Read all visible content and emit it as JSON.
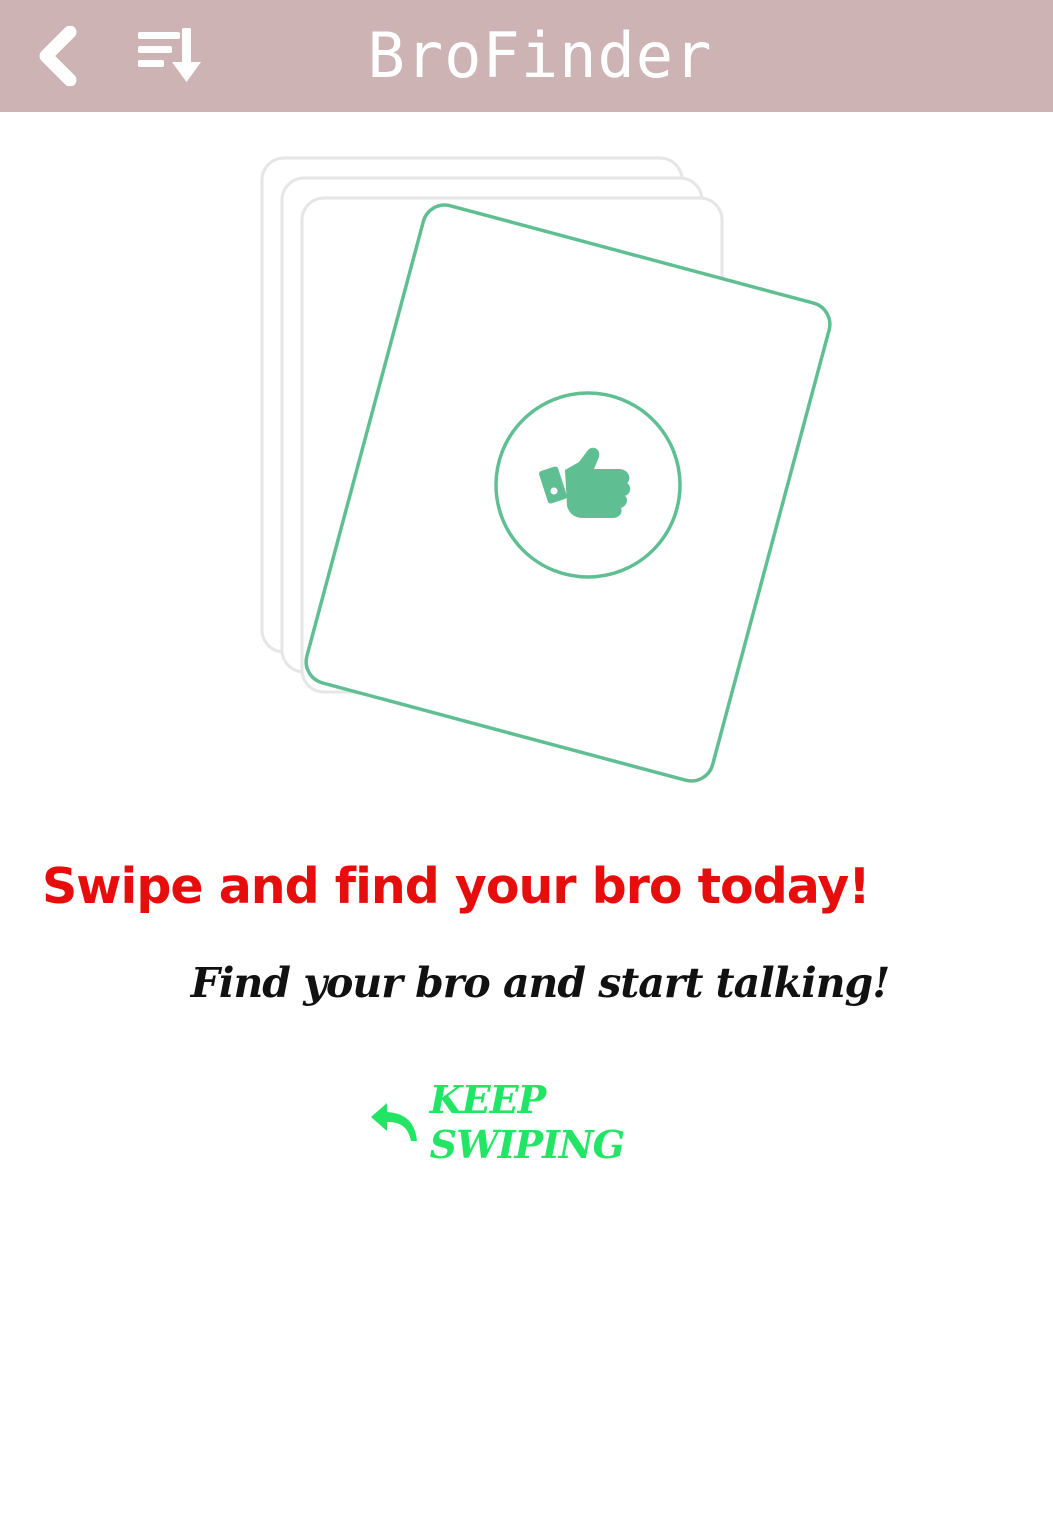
{
  "app_bar": {
    "title": "BroFinder",
    "back_icon": "chevron-left-icon",
    "sort_icon": "sort-down-icon"
  },
  "illustration": {
    "icon": "thumbs-up-icon",
    "accent_color": "#5fbf93",
    "stack_color": "#e6e6e6"
  },
  "content": {
    "headline": "Swipe and find your bro today!",
    "subline": "Find your bro and start talking!"
  },
  "action": {
    "label": "KEEP SWIPING",
    "icon": "reply-arrow-icon",
    "color": "#22e565"
  },
  "colors": {
    "app_bar": "#cdb3b3",
    "headline": "#e80d0d"
  }
}
